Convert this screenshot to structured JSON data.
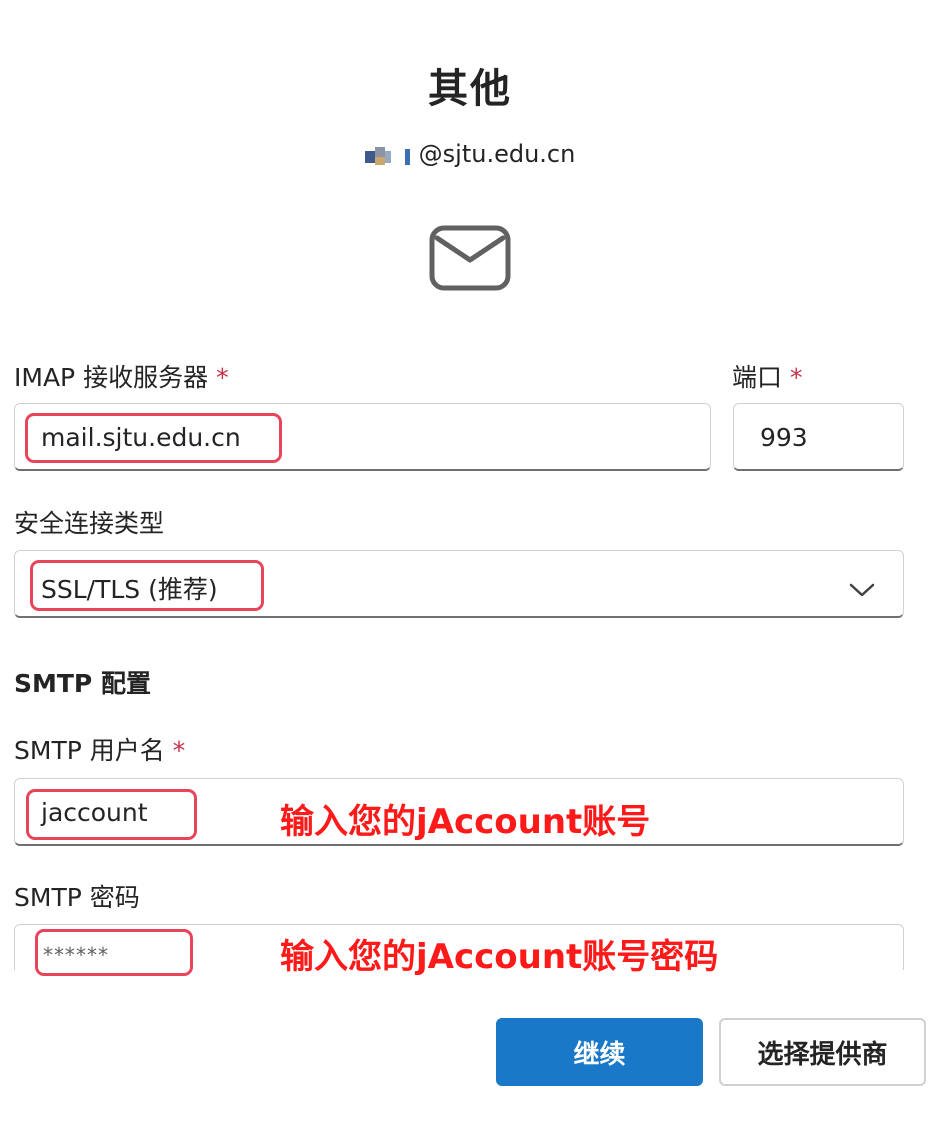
{
  "header": {
    "title": "其他",
    "account_email": "@sjtu.edu.cn"
  },
  "imap": {
    "server_label": "IMAP 接收服务器",
    "server_value": "mail.sjtu.edu.cn",
    "port_label": "端口",
    "port_value": "993",
    "required_mark": "*"
  },
  "security": {
    "label": "安全连接类型",
    "selected": "SSL/TLS (推荐)"
  },
  "smtp": {
    "section_title": "SMTP 配置",
    "username_label": "SMTP 用户名",
    "username_value": "jaccount",
    "username_hint": "输入您的jAccount账号",
    "password_label": "SMTP 密码",
    "password_value": "******",
    "password_hint": "输入您的jAccount账号密码",
    "required_mark": "*"
  },
  "actions": {
    "continue_label": "继续",
    "choose_provider_label": "选择提供商"
  },
  "icons": {
    "mail": "envelope-icon",
    "dropdown": "chevron-down-icon",
    "avatar": "avatar-icon"
  },
  "colors": {
    "primary": "#1a78c8",
    "required": "#c4314b",
    "highlight": "#e8445a",
    "annotation": "#ff1a1a"
  }
}
